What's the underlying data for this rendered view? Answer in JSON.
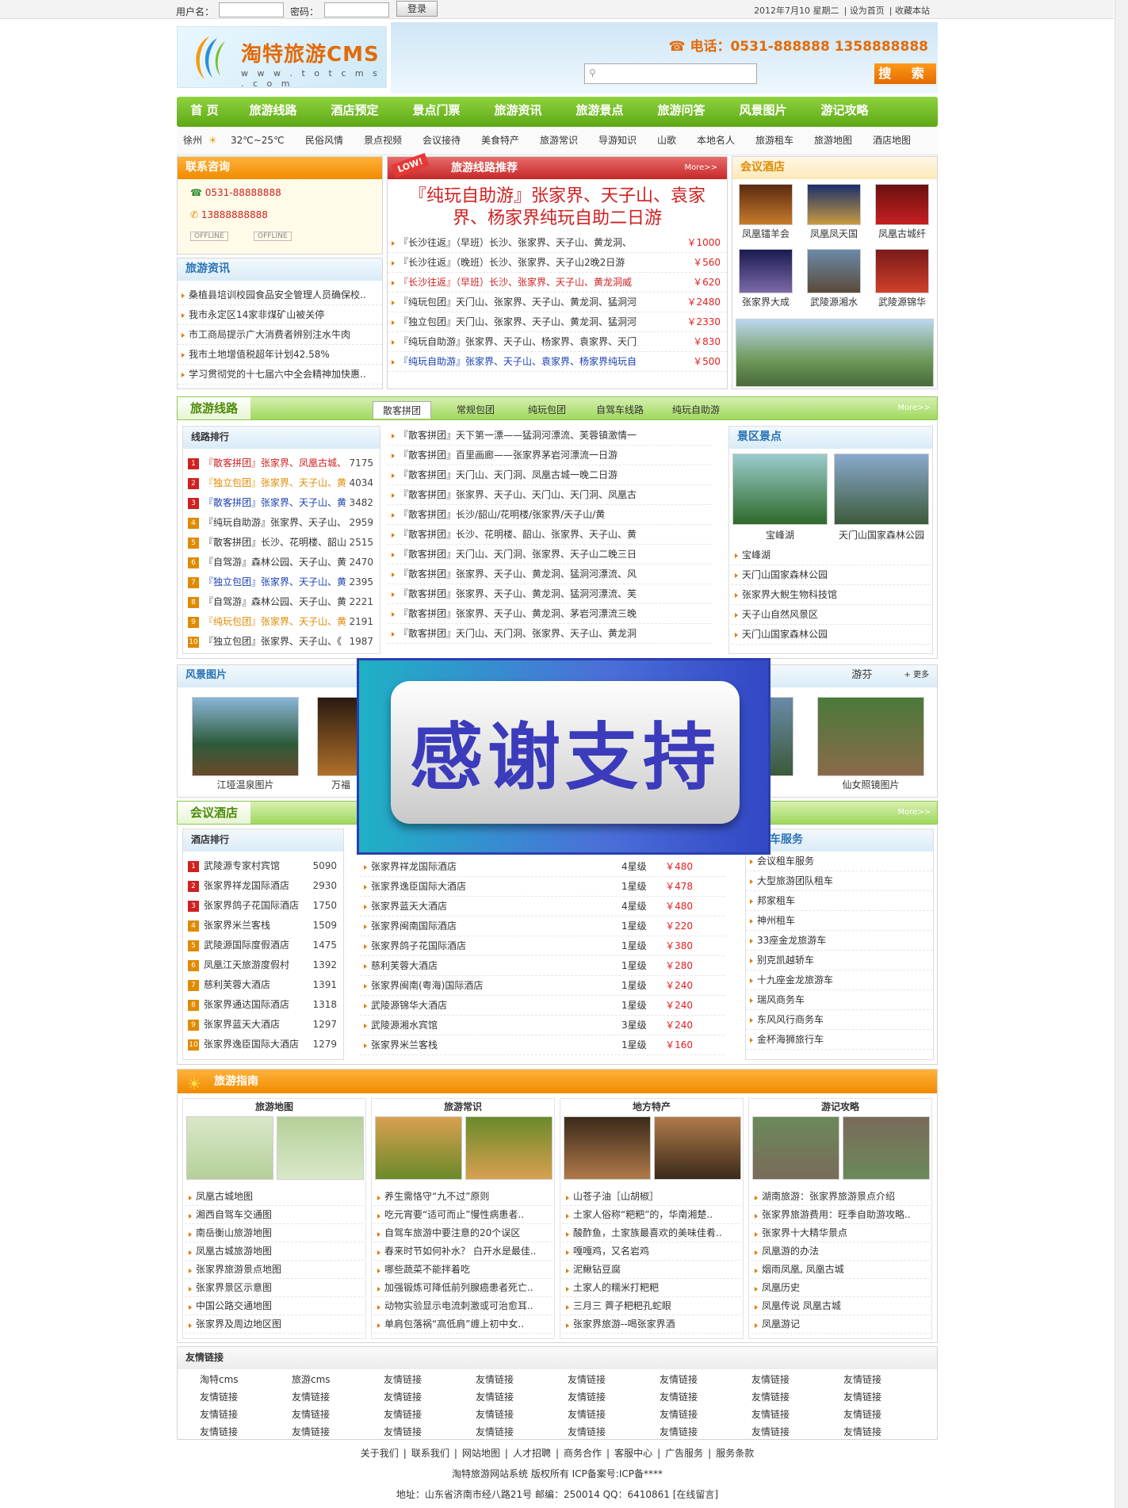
{
  "topbar": {
    "user_label": "用户名：",
    "pass_label": "密码：",
    "login": "登录",
    "date": "2012年7月10 星期二",
    "set_home": "设为首页",
    "favorite": "收藏本站"
  },
  "header": {
    "logo_title": "淘特旅游CMS",
    "logo_url": "w w w . t o t c m s . c o m",
    "phone": "电话：0531-888888 1358888888",
    "search_btn": "搜 索"
  },
  "nav": [
    "首 页",
    "旅游线路",
    "酒店预定",
    "景点门票",
    "旅游资讯",
    "旅游景点",
    "旅游问答",
    "风景图片",
    "游记攻略"
  ],
  "subnav": {
    "city": "徐州",
    "weather": "32℃~25℃",
    "items": [
      "民俗风情",
      "景点视频",
      "会议接待",
      "美食特产",
      "旅游常识",
      "导游知识",
      "山歌",
      "本地名人",
      "旅游租车",
      "旅游地图",
      "酒店地图"
    ]
  },
  "contact": {
    "title": "联系咨询",
    "phone1": "0531-88888888",
    "phone2": "13888888888",
    "offline": "OFFLINE"
  },
  "news": {
    "title": "旅游资讯",
    "items": [
      "桑植县培训校园食品安全管理人员确保校..",
      "我市永定区14家非煤矿山被关停",
      "市工商局提示广大消费者辨别注水牛肉",
      "我市土地增值税超年计划42.58%",
      "学习贯彻党的十七届六中全会精神加快惠.."
    ]
  },
  "routes_rec": {
    "title": "旅游线路推荐",
    "badge": "LOW!",
    "more": "More>>",
    "headline": "『纯玩自助游』张家界、天子山、袁家界、杨家界纯玩自助二日游",
    "items": [
      {
        "t": "『长沙往返』（早班）长沙、张家界、天子山、黄龙洞、",
        "p": "￥1000",
        "c": "#333"
      },
      {
        "t": "『长沙往返』（晚班）长沙、张家界、天子山2晚2日游",
        "p": "￥560",
        "c": "#333"
      },
      {
        "t": "『长沙往返』（早班）长沙、张家界、天子山、黄龙洞威",
        "p": "￥620",
        "c": "#d02020"
      },
      {
        "t": "『纯玩包团』天门山、张家界、天子山、黄龙洞、猛洞河",
        "p": "￥2480",
        "c": "#333"
      },
      {
        "t": "『独立包团』天门山、张家界、天子山、黄龙洞、猛洞河",
        "p": "￥2330",
        "c": "#333"
      },
      {
        "t": "『纯玩自助游』张家界、天子山、杨家界、袁家界、天门",
        "p": "￥830",
        "c": "#333"
      },
      {
        "t": "『纯玩自助游』张家界、天子山、袁家界、杨家界纯玩自",
        "p": "￥500",
        "c": "#1a3fb0"
      }
    ]
  },
  "meeting_hotel_top": {
    "title": "会议酒店",
    "items": [
      "凤凰镭羊会",
      "凤凰凤天国",
      "凤凰古城纤",
      "张家界大成",
      "武陵源湘水",
      "武陵源锦华"
    ]
  },
  "routes": {
    "title": "旅游线路",
    "more": "More>>",
    "tabs": [
      "散客拼团",
      "常规包团",
      "纯玩包团",
      "自驾车线路",
      "纯玩自助游"
    ],
    "rank_title": "线路排行",
    "rank": [
      {
        "t": "『散客拼团』张家界、凤凰古城、",
        "n": "7175",
        "c": "#d02020"
      },
      {
        "t": "『独立包团』张家界、天子山、黄",
        "n": "4034",
        "c": "#e08a00"
      },
      {
        "t": "『散客拼团』张家界、天子山、黄",
        "n": "3482",
        "c": "#1a3fb0"
      },
      {
        "t": "『纯玩自助游』张家界、天子山、",
        "n": "2959",
        "c": "#333"
      },
      {
        "t": "『散客拼团』长沙、花明楼、韶山",
        "n": "2515",
        "c": "#333"
      },
      {
        "t": "『自驾游』森林公园、天子山、黄",
        "n": "2470",
        "c": "#333"
      },
      {
        "t": "『独立包团』张家界、天子山、黄",
        "n": "2395",
        "c": "#1a3fb0"
      },
      {
        "t": "『自驾游』森林公园、天子山、黄",
        "n": "2221",
        "c": "#333"
      },
      {
        "t": "『纯玩包团』张家界、天子山、黄",
        "n": "2191",
        "c": "#e08a00"
      },
      {
        "t": "『独立包团』张家界、天子山、《",
        "n": "1987",
        "c": "#333"
      }
    ],
    "list": [
      "『散客拼团』天下第一漂——猛洞河漂流、芙蓉镇激情一",
      "『散客拼团』百里画廊——张家界茅岩河漂流一日游",
      "『散客拼团』天门山、天门洞、凤凰古城一晚二日游",
      "『散客拼团』张家界、天子山、天门山、天门洞、凤凰古",
      "『散客拼团』长沙/韶山/花明楼/张家界/天子山/黄",
      "『散客拼团』长沙、花明楼、韶山、张家界、天子山、黄",
      "『散客拼团』天门山、天门洞、张家界、天子山二晚三日",
      "『散客拼团』张家界、天子山、黄龙洞、猛洞河漂流、风",
      "『散客拼团』张家界、天子山、黄龙洞、猛洞河漂流、芙",
      "『散客拼团』张家界、天子山、黄龙洞、茅岩河漂流三晚",
      "『散客拼团』天门山、天门洞、张家界、天子山、黄龙洞"
    ]
  },
  "scenic": {
    "title": "景区景点",
    "pic1": "宝峰湖",
    "pic2": "天门山国家森林公园",
    "items": [
      "宝峰湖",
      "天门山国家森林公园",
      "张家界大鲵生物科技馆",
      "天子山自然风景区",
      "天门山国家森林公园"
    ]
  },
  "photos": {
    "title": "风景图片",
    "more": "+ 更多",
    "cap1": "江垭温泉图片",
    "cap2": "万福",
    "cap_right": "仙女照镜图片",
    "partial": "游芬"
  },
  "overlay": {
    "text": "感谢支持"
  },
  "hotels": {
    "title": "会议酒店",
    "more": "More>>",
    "rank_title": "酒店排行",
    "rank": [
      {
        "t": "武陵源专家村宾馆",
        "n": "5090"
      },
      {
        "t": "张家界祥龙国际酒店",
        "n": "2930"
      },
      {
        "t": "张家界鸽子花国际酒店",
        "n": "1750"
      },
      {
        "t": "张家界米兰客栈",
        "n": "1509"
      },
      {
        "t": "武陵源国际度假酒店",
        "n": "1475"
      },
      {
        "t": "凤凰江天旅游度假村",
        "n": "1392"
      },
      {
        "t": "慈利芙蓉大酒店",
        "n": "1391"
      },
      {
        "t": "张家界通达国际酒店",
        "n": "1318"
      },
      {
        "t": "张家界蓝天大酒店",
        "n": "1297"
      },
      {
        "t": "张家界逸臣国际大酒店",
        "n": "1279"
      }
    ],
    "list": [
      {
        "t": "张家界祥龙国际酒店",
        "s": "4星级",
        "p": "￥480"
      },
      {
        "t": "张家界逸臣国际大酒店",
        "s": "1星级",
        "p": "￥478"
      },
      {
        "t": "张家界蓝天大酒店",
        "s": "4星级",
        "p": "￥480"
      },
      {
        "t": "张家界闽南国际酒店",
        "s": "1星级",
        "p": "￥220"
      },
      {
        "t": "张家界鸽子花国际酒店",
        "s": "1星级",
        "p": "￥380"
      },
      {
        "t": "慈利芙蓉大酒店",
        "s": "1星级",
        "p": "￥280"
      },
      {
        "t": "张家界闽南(粤海)国际酒店",
        "s": "1星级",
        "p": "￥240"
      },
      {
        "t": "武陵源锦华大酒店",
        "s": "1星级",
        "p": "￥240"
      },
      {
        "t": "武陵源湘水宾馆",
        "s": "3星级",
        "p": "￥240"
      },
      {
        "t": "张家界米兰客栈",
        "s": "1星级",
        "p": "￥160"
      }
    ],
    "car_title": "车服务",
    "cars": [
      "会议租车服务",
      "大型旅游团队租车",
      "邦家租车",
      "神州租车",
      "33座金龙旅游车",
      "别克凯越轿车",
      "十九座金龙旅游车",
      "瑞风商务车",
      "东风风行商务车",
      "金杯海狮旅行车"
    ]
  },
  "guide": {
    "title": "旅游指南",
    "cols": [
      {
        "h": "旅游地图",
        "items": [
          "凤凰古城地图",
          "湘西自驾车交通图",
          "南岳衡山旅游地图",
          "凤凰古城旅游地图",
          "张家界旅游景点地图",
          "张家界景区示意图",
          "中国公路交通地图",
          "张家界及周边地区图"
        ]
      },
      {
        "h": "旅游常识",
        "items": [
          "养生需恪守“九不过”原则",
          "吃元宵要“适可而止”慢性病患者..",
          "自驾车旅游中要注意的20个误区",
          "春来时节如何补水？ 白开水是最佳..",
          "哪些蔬菜不能拌着吃",
          "加强锻炼可降低前列腺癌患者死亡..",
          "动物实验显示电流刺激或可治愈耳..",
          "单肩包落祸“高低肩”缠上初中女.."
        ]
      },
      {
        "h": "地方特产",
        "items": [
          "山苍子油［山胡椒］",
          "土家人俗称“粑粑”的，华南湘楚..",
          "酸酢鱼，土家族最喜欢的美味佳肴..",
          "嘎嘎鸡，又名岩鸡",
          "泥鳅钻豆腐",
          "土家人的糯米打粑粑",
          "三月三 薺子粑粑孔蛇眼",
          "张家界旅游--喝张家界酒"
        ]
      },
      {
        "h": "游记攻略",
        "items": [
          "湖南旅游：张家界旅游景点介绍",
          "张家界旅游费用：旺季自助游攻略..",
          "张家界十大精华景点",
          "凤凰游的办法",
          "烟雨凤凰, 凤凰古城",
          "凤凰历史",
          "凤凰传说 凤凰古城",
          "凤凰游记"
        ]
      }
    ]
  },
  "links": {
    "title": "友情链接",
    "first": [
      "淘特cms",
      "旅游cms"
    ],
    "generic": "友情链接"
  },
  "footer": {
    "links": [
      "关于我们",
      "联系我们",
      "网站地图",
      "人才招聘",
      "商务合作",
      "客服中心",
      "广告服务",
      "服务条款"
    ],
    "copy": "淘特旅游网站系统 版权所有 ICP备案号:ICP备****",
    "addr": "地址：山东省济南市经八路21号 邮编：250014 QQ：6410861 [在线留言]"
  },
  "colors": {
    "green": "#6cb421",
    "orange": "#f08a00",
    "price": "#e02020"
  }
}
